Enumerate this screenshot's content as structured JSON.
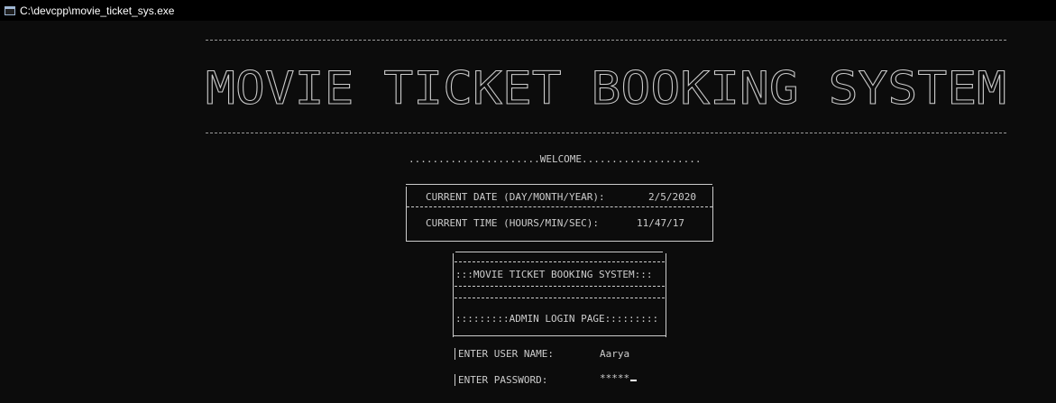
{
  "window": {
    "title": "C:\\devcpp\\movie_ticket_sys.exe"
  },
  "banner": {
    "text": "MOVIE TICKET BOOKING SYSTEM"
  },
  "welcome": {
    "text": "......................WELCOME...................."
  },
  "datetime": {
    "date_label": "CURRENT DATE (DAY/MONTH/YEAR):",
    "date_value": "2/5/2020",
    "time_label": "CURRENT TIME (HOURS/MIN/SEC):",
    "time_value": "11/47/17"
  },
  "menu": {
    "system_title": ":::MOVIE TICKET BOOKING SYSTEM:::",
    "page_title": ":::::::::ADMIN LOGIN PAGE:::::::::"
  },
  "login": {
    "username_label": "ENTER USER NAME:",
    "username_value": "Aarya",
    "password_label": "ENTER PASSWORD:",
    "password_value": "*****"
  },
  "colors": {
    "background": "#0c0c0c",
    "text": "#cccccc",
    "titlebar": "#000000"
  }
}
